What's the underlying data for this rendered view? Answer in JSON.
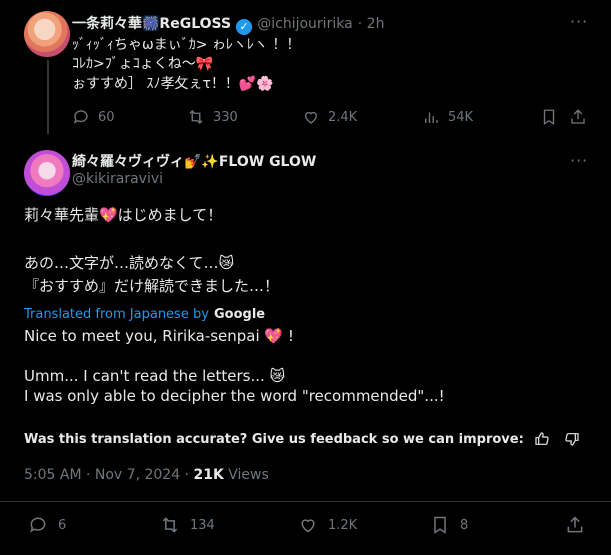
{
  "quoted": {
    "name": "一条莉々華🎆ReGLOSS",
    "handle": "@ichijouririka",
    "time": "· 2h",
    "more": "···",
    "lines": [
      "ｯﾞｨｯﾞｨちゃωまぃﾞｶ> ゎﾚヽﾚヽ ！！",
      "ｺﾚｶ>ﾌﾞょｺょくね～🎀",
      "ぉすすめ］ ｽﾉ孝攵ぇτ！！💕🌸"
    ],
    "actions": {
      "replies": "60",
      "reposts": "330",
      "likes": "2.4K",
      "views": "54K"
    }
  },
  "post": {
    "name": "綺々羅々ヴィヴィ💅✨FLOW GLOW",
    "handle": "@kikiraravivi",
    "more": "···",
    "lines": [
      "莉々華先輩💖はじめまして！",
      "あの…文字が…読めなくて…😿",
      "『おすすめ』だけ解読できました…！"
    ],
    "translated_label": "Translated from Japanese by",
    "translator": "Google",
    "translation": [
      "Nice to meet you, Ririka-senpai 💖 !",
      "Umm... I can't read the letters... 😿",
      "I was only able to decipher the word \"recommended\"...!"
    ],
    "feedback": "Was this translation accurate? Give us feedback so we can improve:",
    "time": "5:05 AM · Nov 7, 2024 ·",
    "views_count": "21K",
    "views_label": "Views",
    "actions": {
      "replies": "6",
      "reposts": "134",
      "likes": "1.2K",
      "bookmarks": "8"
    }
  },
  "colors": {
    "background": "#000000",
    "text": "#e7e9ea",
    "muted": "#71767b",
    "accent": "#1d9bf0"
  }
}
